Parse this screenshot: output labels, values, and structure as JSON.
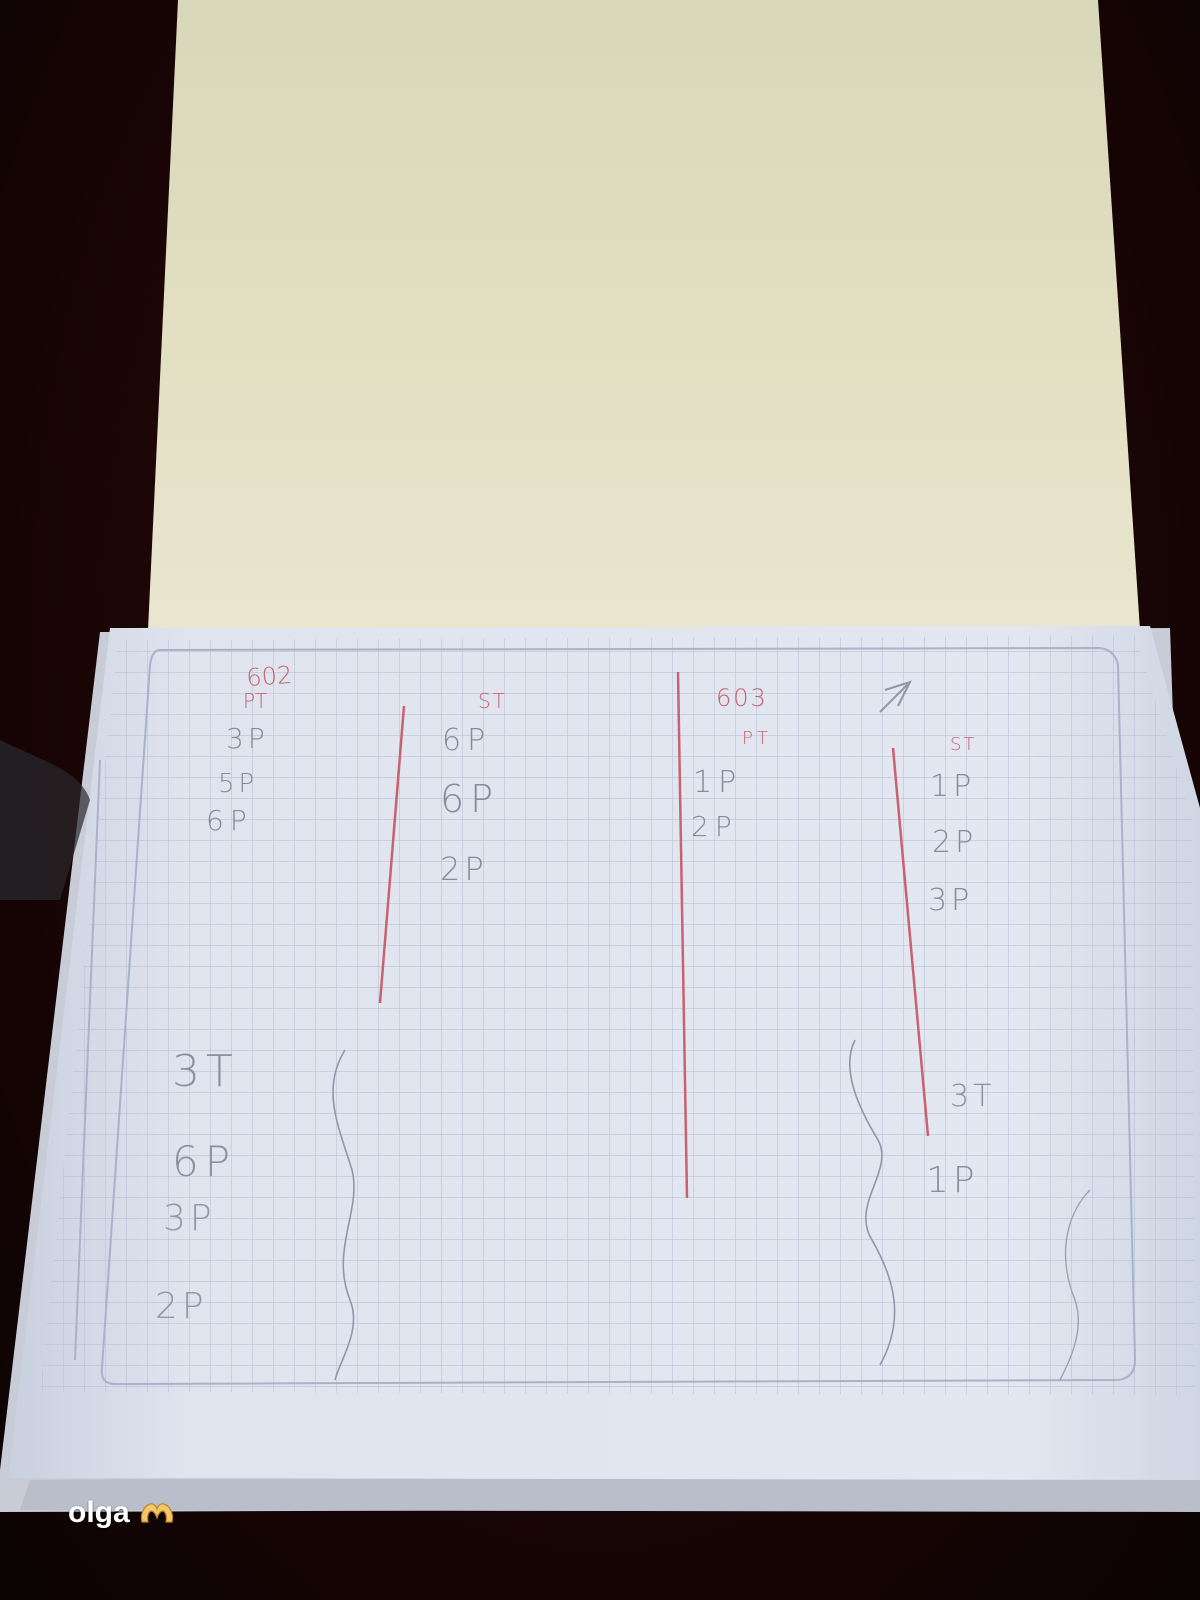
{
  "caption": {
    "name": "olga",
    "emoji_icon": "heart-hands-icon"
  },
  "notes": {
    "col1": {
      "header_top": "602",
      "header_sub": "PT",
      "lines": [
        "3P",
        "5P",
        "6P"
      ],
      "lower_header": "3T",
      "lower_lines": [
        "6P",
        "3P",
        "2P"
      ]
    },
    "col2": {
      "header": "ST",
      "lines": [
        "6P",
        "6P",
        "2P"
      ]
    },
    "col3": {
      "header_top": "603",
      "header_sub": "PT",
      "lines": [
        "1P",
        "2P"
      ]
    },
    "col4": {
      "header": "ST",
      "lines": [
        "1P",
        "2P",
        "3P"
      ],
      "lower_header": "3T",
      "lower_lines": [
        "1P"
      ]
    }
  },
  "colors": {
    "pen_red": "#c8626e",
    "pencil": "#8a8f9c",
    "paper": "#dde3ef",
    "grid": "#b7c0d4",
    "cover": "#e4e1c4"
  }
}
